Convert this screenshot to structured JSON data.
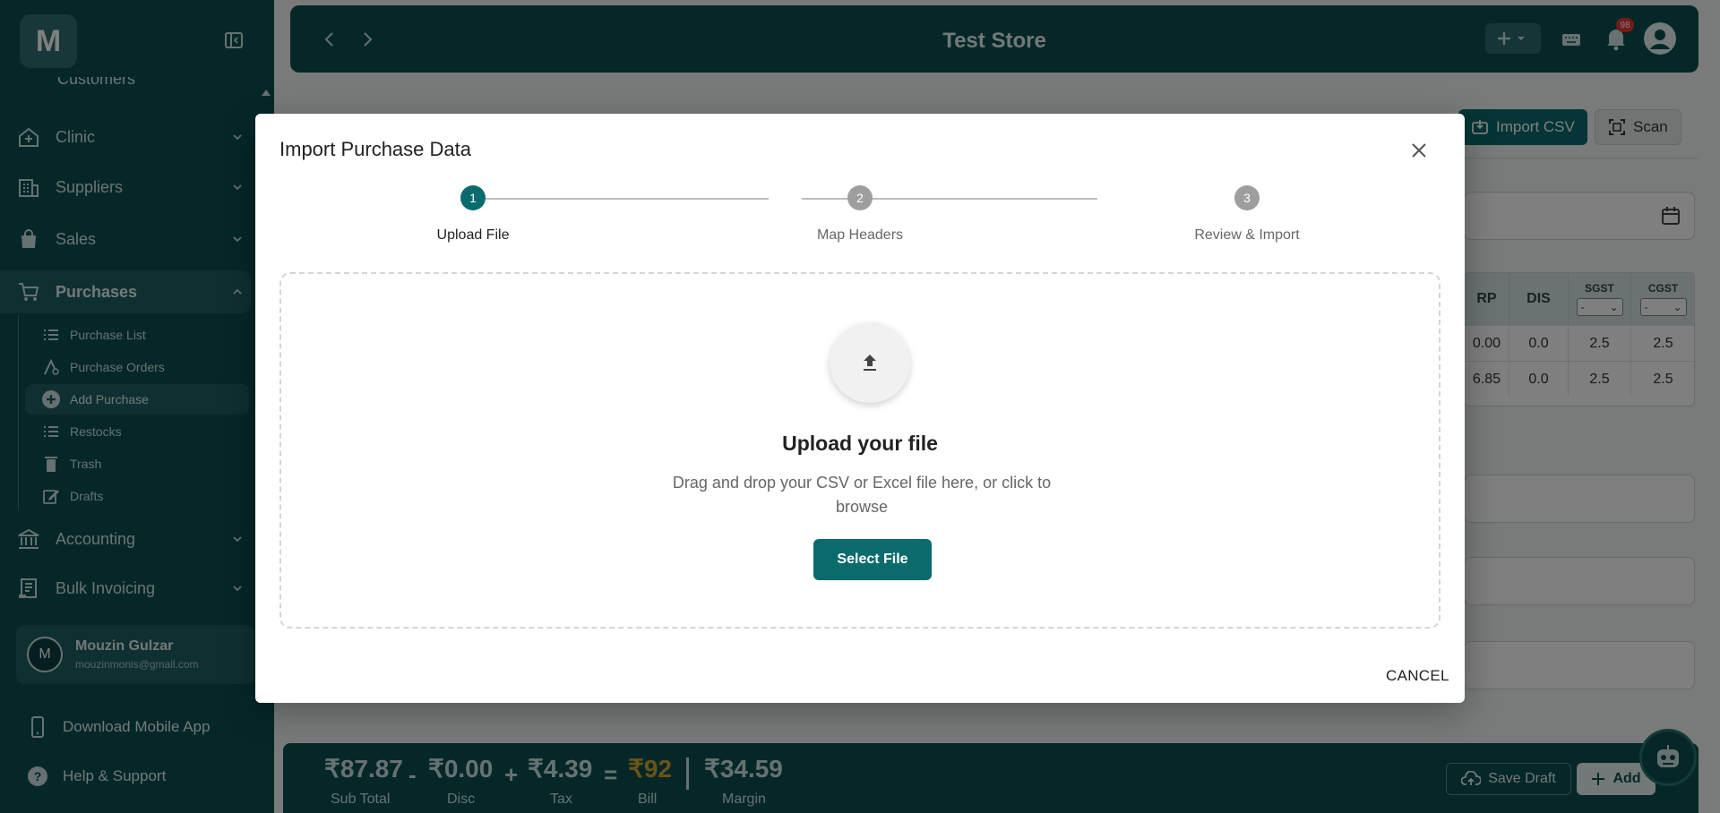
{
  "sidebar": {
    "partial_top_label": "Customers",
    "items": [
      {
        "label": "Clinic"
      },
      {
        "label": "Suppliers"
      },
      {
        "label": "Sales"
      },
      {
        "label": "Purchases"
      },
      {
        "label": "Accounting"
      },
      {
        "label": "Bulk Invoicing"
      }
    ],
    "sub_items": [
      {
        "label": "Purchase List"
      },
      {
        "label": "Purchase Orders"
      },
      {
        "label": "Add Purchase"
      },
      {
        "label": "Restocks"
      },
      {
        "label": "Trash"
      },
      {
        "label": "Drafts"
      }
    ],
    "user": {
      "initial": "M",
      "name": "Mouzin Gulzar",
      "email": "mouzinmonis@gmail.com"
    },
    "download_app": "Download Mobile App",
    "help": "Help & Support",
    "logo_letter": "M"
  },
  "header": {
    "title": "Test Store",
    "notification_count": "98"
  },
  "page": {
    "import_csv_label": "Import CSV",
    "scan_label": "Scan",
    "table": {
      "headers": [
        "RP",
        "DIS",
        "SGST",
        "CGST"
      ],
      "select_value": "-",
      "rows": [
        [
          "0.00",
          "0.0",
          "2.5",
          "2.5"
        ],
        [
          "6.85",
          "0.0",
          "2.5",
          "2.5"
        ]
      ]
    }
  },
  "footer": {
    "sub_total": "₹87.87",
    "sub_total_label": "Sub Total",
    "disc": "₹0.00",
    "disc_label": "Disc",
    "tax": "₹4.39",
    "tax_label": "Tax",
    "bill": "₹92",
    "bill_label": "Bill",
    "margin": "₹34.59",
    "margin_label": "Margin",
    "op_minus": "-",
    "op_plus": "+",
    "op_equals": "=",
    "save_draft": "Save Draft",
    "add": "Add"
  },
  "modal": {
    "title": "Import Purchase Data",
    "steps": [
      {
        "number": "1",
        "label": "Upload File"
      },
      {
        "number": "2",
        "label": "Map Headers"
      },
      {
        "number": "3",
        "label": "Review & Import"
      }
    ],
    "active_step": 1,
    "dropzone_title": "Upload your file",
    "dropzone_text": "Drag and drop your CSV or Excel file here, or click to browse",
    "select_file": "Select File",
    "cancel": "CANCEL"
  },
  "colors": {
    "brand": "#0b4f50",
    "accent": "#0b6b6c",
    "bill_highlight": "#d4a72c",
    "badge": "#e53935"
  },
  "icons": {
    "nav": [
      "hospital-icon",
      "building-icon",
      "shopping-bag-icon",
      "cart-icon",
      "bank-icon",
      "receipt-icon"
    ],
    "sub": [
      "list-icon",
      "compass-icon",
      "plus-circle-icon",
      "list-icon",
      "trash-icon",
      "edit-icon"
    ]
  }
}
